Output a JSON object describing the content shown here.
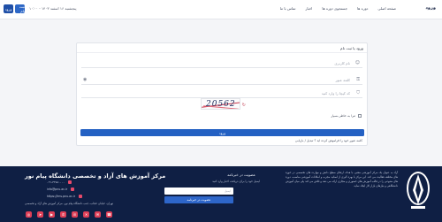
{
  "header": {
    "brand": "ورود",
    "nav": [
      "صفحه اصلی",
      "دوره ها",
      "جستجوی دوره ها",
      "اخبار",
      "تماس با ما"
    ],
    "date": "پنجشنبه ۱۶ اسفند ۱۴۰۳ - ۱۰:۰۰",
    "login_label": "ورود",
    "register_label": "ثبت نام"
  },
  "login": {
    "title": "ورود یا ثبت نام",
    "username_placeholder": "نام کاربری",
    "password_placeholder": "کلمه عبور",
    "captcha_placeholder": "کد کپچا را وارد کنید",
    "captcha_text": "20562",
    "remember_label": "مرا به خاطر بسپار",
    "submit_label": "ورود",
    "forgot_text": "کلمه عبور خود را فراموش کرده اید ؟ تبدیل / بازیابی"
  },
  "footer": {
    "about": "آزاد به عنوان یک مرکز آموزشی معتبر، با هدف ارتقای سطح دانش و مهارت های تخصصی در حوزه های مختلف فعالیت می کند. این مرکز با بهره گیری از اساتید مجرب و امکانات آموزشی مناسب، دوره های متنوعی را در قالب آموزش های حضوری و مجازی ارائه می دهد و تلاش می کند پلی میان آموزش دانشگاهی و نیازهای بازار کار ایجاد نماید.",
    "newsletter_title": "عضویت در خبرنامه",
    "newsletter_sub": "ایمیل خود را برای دریافت اخبار وارد کنید",
    "newsletter_placeholder": "ایمیل",
    "newsletter_button": "عضویت در خبرنامه",
    "org_name": "مرکز آموزش های آزاد و تخصصی دانشگاه پیام نور",
    "phone": "۰۲۱-۴۴۸۸۰۰۰۰",
    "email": "info@pnu.ac.ir",
    "website": "https://lms.pnu.ac.ir",
    "address": "تهران، خیابان حجاب، جنب دانشگاه پیام نور، مرکز آموزش های آزاد و تخصصی",
    "social_icons": [
      "instagram-icon",
      "telegram-icon",
      "youtube-icon",
      "whatsapp-icon",
      "linkedin-icon",
      "twitter-icon",
      "email-icon",
      "phone-icon"
    ]
  },
  "colors": {
    "primary": "#2461c3",
    "footer_bg": "#0f1f44",
    "accent": "#df3f57"
  }
}
